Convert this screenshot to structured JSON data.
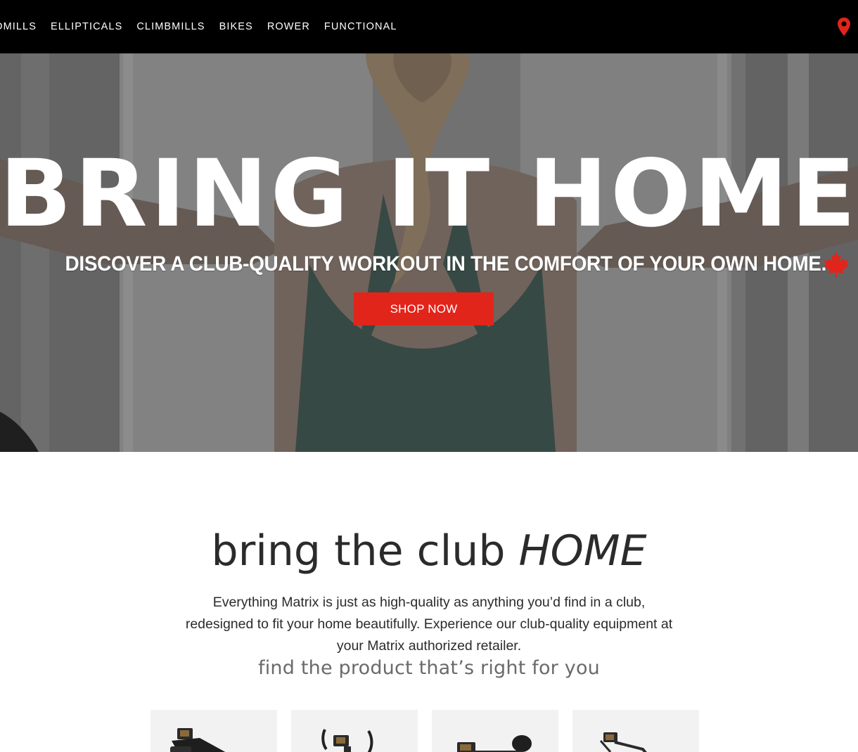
{
  "nav": {
    "items": [
      {
        "label": "DMILLS"
      },
      {
        "label": "ELLIPTICALS"
      },
      {
        "label": "CLIMBMILLS"
      },
      {
        "label": "BIKES"
      },
      {
        "label": "ROWER"
      },
      {
        "label": "FUNCTIONAL"
      }
    ],
    "location_icon": "location-pin-icon",
    "pin_color": "#e1251b"
  },
  "hero": {
    "title": "BRING IT HOME",
    "subtitle": "DISCOVER A CLUB-QUALITY WORKOUT IN THE COMFORT OF YOUR OWN HOME.",
    "flag_icon": "maple-leaf-icon",
    "cta_label": "SHOP NOW",
    "cta_color": "#e1251b"
  },
  "intro": {
    "heading_part1": "bring the club ",
    "heading_part2": "HOME",
    "copy": "Everything Matrix is just as high-quality as anything you’d find in a club, redesigned to fit your home beautifully. Experience our club-quality equipment at your Matrix authorized retailer.",
    "sub": "find the product that’s right for you"
  },
  "products": [
    {
      "icon": "treadmill-icon"
    },
    {
      "icon": "elliptical-icon"
    },
    {
      "icon": "bike-icon"
    },
    {
      "icon": "climbmill-icon"
    }
  ]
}
